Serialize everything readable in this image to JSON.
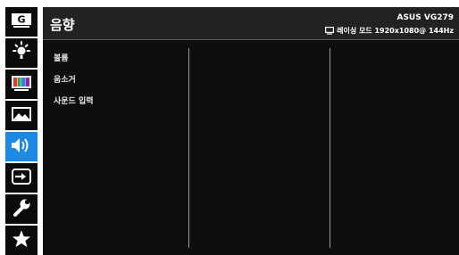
{
  "sidebar": {
    "items": [
      {
        "icon": "gamevisual-g-icon",
        "active": false
      },
      {
        "icon": "brightness-sun-icon",
        "active": false
      },
      {
        "icon": "color-bars-icon",
        "active": false
      },
      {
        "icon": "image-icon",
        "active": false
      },
      {
        "icon": "speaker-icon",
        "active": true
      },
      {
        "icon": "input-select-icon",
        "active": false
      },
      {
        "icon": "wrench-icon",
        "active": false
      },
      {
        "icon": "star-icon",
        "active": false
      }
    ],
    "g_label": "G"
  },
  "header": {
    "title": "음향",
    "model": "ASUS VG279",
    "status": "레이싱 모드 1920x1080@ 144Hz"
  },
  "menu": {
    "items": [
      "볼륨",
      "음소거",
      "사운드 입력"
    ]
  },
  "colors": {
    "active": "#1e88e5",
    "panel": "#0e0e0e",
    "header": "#222222"
  }
}
